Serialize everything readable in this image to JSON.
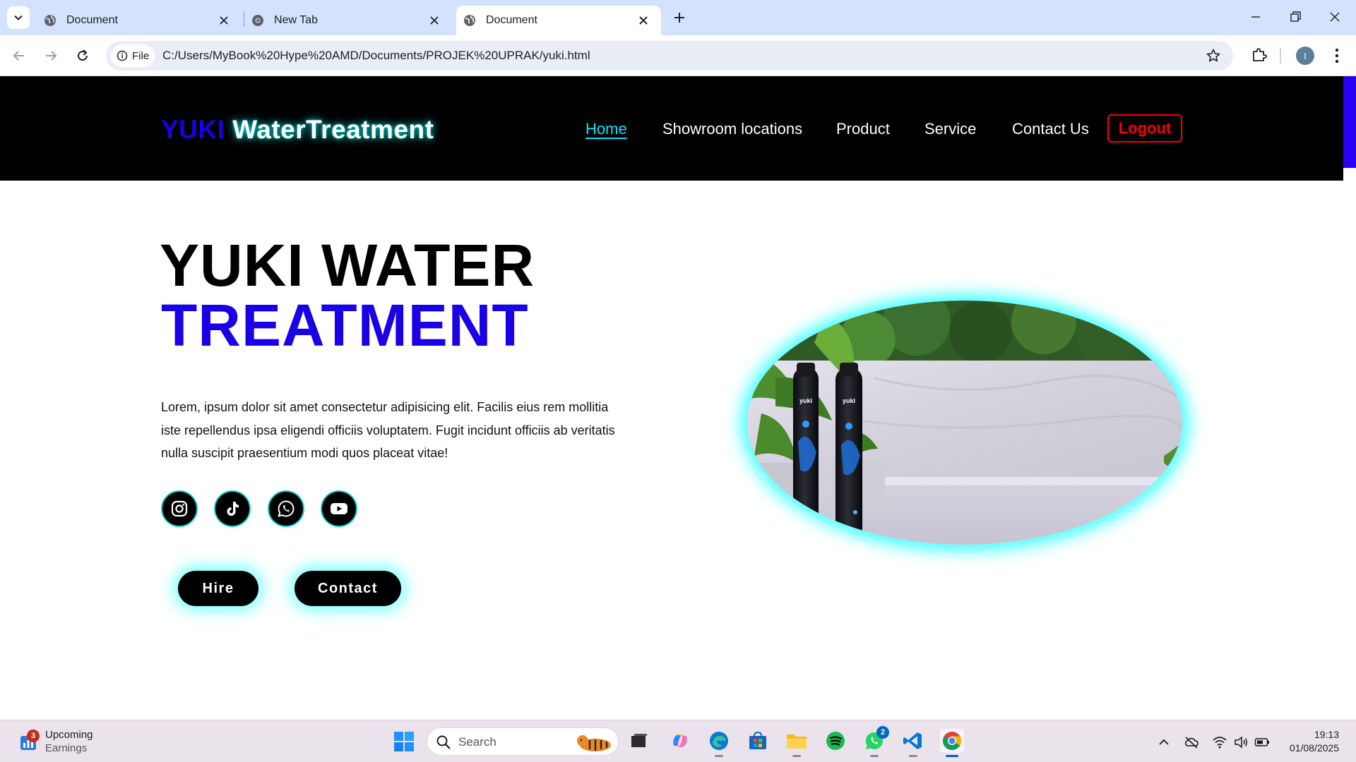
{
  "browser": {
    "tabs": [
      {
        "title": "Document",
        "active": false
      },
      {
        "title": "New Tab",
        "active": false
      },
      {
        "title": "Document",
        "active": true
      }
    ],
    "site_chip": "File",
    "url": "C:/Users/MyBook%20Hype%20AMD/Documents/PROJEK%20UPRAK/yuki.html",
    "profile_initial": "I"
  },
  "site": {
    "logo": {
      "part1": "YUKI",
      "part2": "WaterTreatment"
    },
    "nav": [
      "Home",
      "Showroom locations",
      "Product",
      "Service",
      "Contact Us"
    ],
    "logout_label": "Logout",
    "hero": {
      "title_line1": "YUKI WATER",
      "title_line2": "TREATMENT",
      "paragraph": "Lorem, ipsum dolor sit amet consectetur adipisicing elit. Facilis eius rem mollitia iste repellendus ipsa eligendi officiis voluptatem. Fugit incidunt officiis ab veritatis nulla suscipit praesentium modi quos placeat vitae!",
      "social": [
        "instagram-icon",
        "tiktok-icon",
        "whatsapp-icon",
        "youtube-icon"
      ],
      "buttons": {
        "hire": "Hire",
        "contact": "Contact"
      },
      "product_label": "yuki"
    },
    "colors": {
      "brand_blue": "#1a00e6",
      "glow": "#00ffff",
      "logout_red": "#ff0000",
      "header_bg": "#000000"
    }
  },
  "taskbar": {
    "widget": {
      "title": "Upcoming",
      "subtitle": "Earnings",
      "badge": "3"
    },
    "search_placeholder": "Search",
    "whatsapp_badge": "2",
    "clock": {
      "time": "19:13",
      "date": "01/08/2025"
    }
  }
}
